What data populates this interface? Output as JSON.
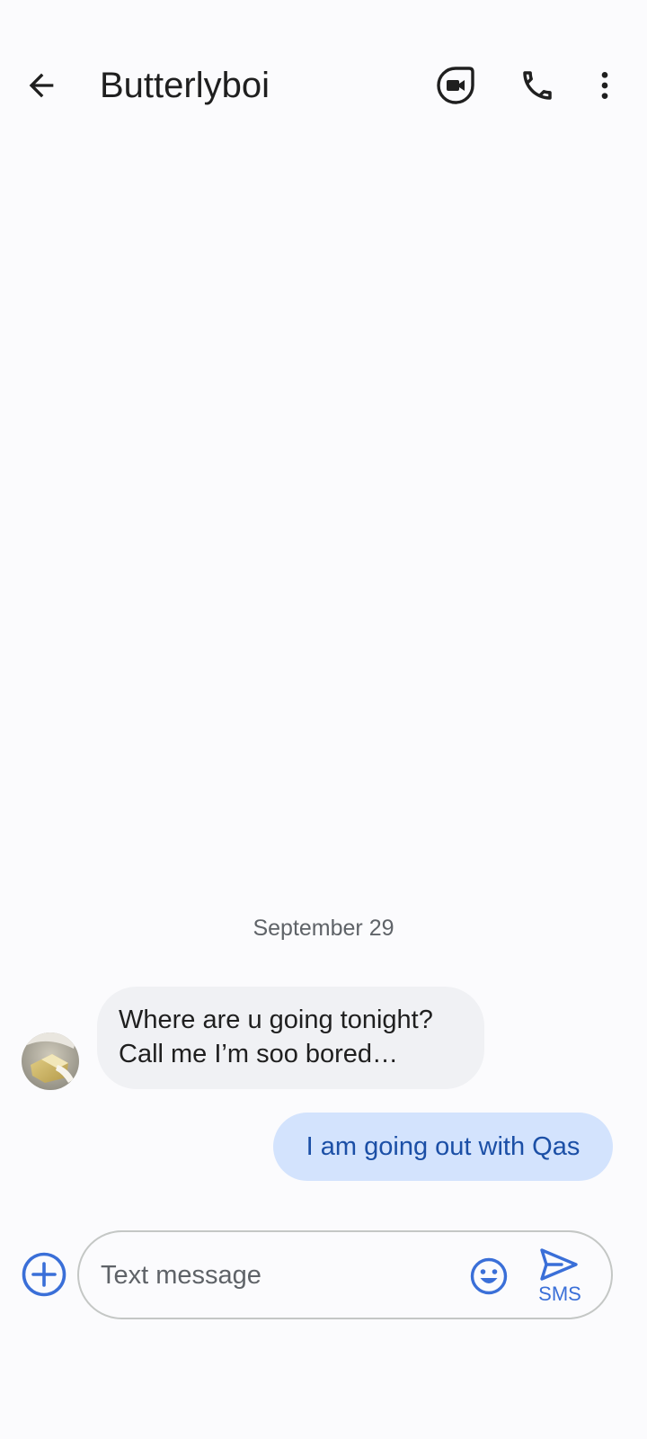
{
  "header": {
    "title": "Butterlyboi",
    "back_icon": "arrow-back-icon",
    "video_icon": "video-call-icon",
    "call_icon": "phone-icon",
    "more_icon": "more-vert-icon"
  },
  "conversation": {
    "date_separator": "September 29",
    "messages": [
      {
        "direction": "incoming",
        "lines": [
          "Where are u going tonight?",
          "Call me I’m soo bored…"
        ]
      },
      {
        "direction": "outgoing",
        "text": "I am going out with Qas"
      }
    ]
  },
  "composer": {
    "placeholder": "Text message",
    "value": "",
    "add_icon": "add-circle-icon",
    "emoji_icon": "emoji-icon",
    "send_icon": "send-icon",
    "send_label": "SMS"
  },
  "colors": {
    "background": "#fbfbfd",
    "incoming_bubble": "#f0f1f4",
    "outgoing_bubble": "#d3e3fd",
    "outgoing_text": "#1b4fa6",
    "accent": "#3a6fd8"
  }
}
